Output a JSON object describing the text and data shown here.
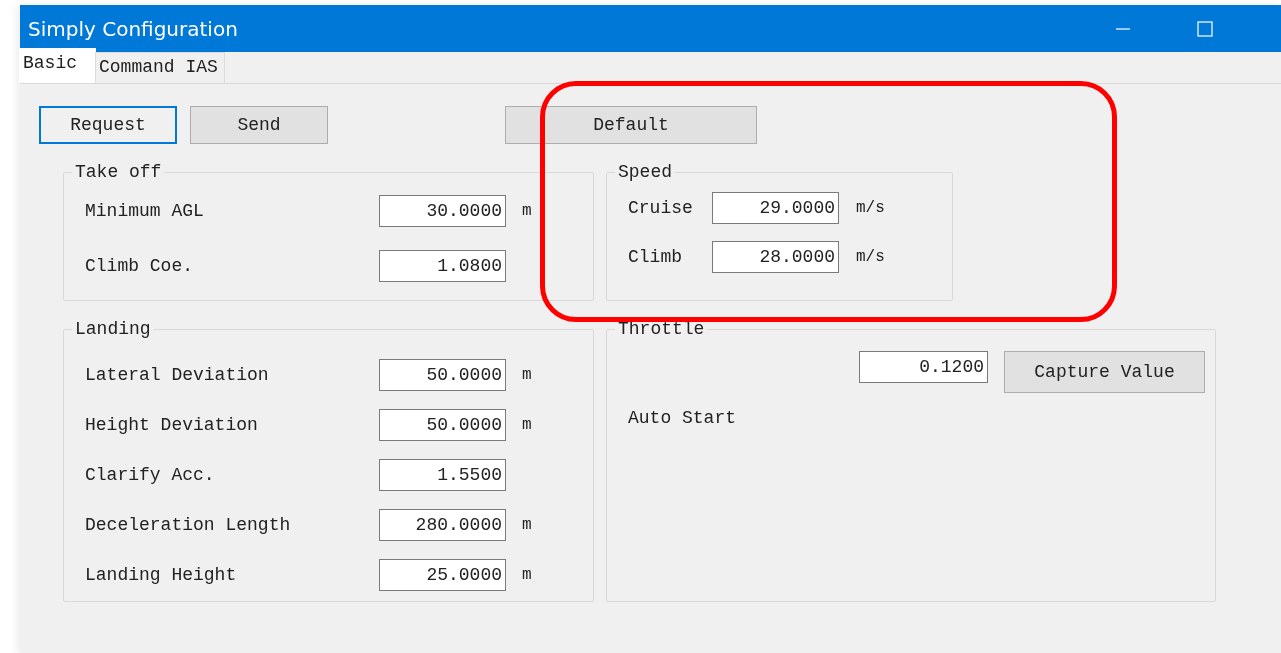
{
  "window": {
    "title": "Simply Configuration"
  },
  "tabs": [
    {
      "label": "Basic",
      "selected": true
    },
    {
      "label": "Command IAS",
      "selected": false
    }
  ],
  "buttons": [
    {
      "label": "Request",
      "focused": true
    },
    {
      "label": "Send",
      "focused": false
    },
    {
      "label": "Default",
      "focused": false
    }
  ],
  "groups": [
    {
      "kind": "fields",
      "title": "Take off",
      "fields": [
        {
          "label": "Minimum AGL",
          "value": "30.0000",
          "unit": "m"
        },
        {
          "label": "Climb Coe.",
          "value": "1.0800"
        }
      ]
    },
    {
      "kind": "fields",
      "title": "Speed",
      "fields": [
        {
          "label": "Cruise",
          "value": "29.0000",
          "unit": "m/s"
        },
        {
          "label": "Climb",
          "value": "28.0000",
          "unit": "m/s"
        }
      ]
    },
    {
      "kind": "fields",
      "title": "Landing",
      "fields": [
        {
          "label": "Lateral Deviation",
          "value": "50.0000",
          "unit": "m"
        },
        {
          "label": "Height Deviation",
          "value": "50.0000",
          "unit": "m"
        },
        {
          "label": "Clarify Acc.",
          "value": "1.5500"
        },
        {
          "label": "Deceleration Length",
          "value": "280.0000",
          "unit": "m"
        },
        {
          "label": "Landing Height",
          "value": "25.0000",
          "unit": "m"
        }
      ]
    },
    {
      "kind": "throttle",
      "title": "Throttle",
      "value": "0.1200",
      "button": "Capture Value",
      "label": "Auto Start"
    }
  ]
}
